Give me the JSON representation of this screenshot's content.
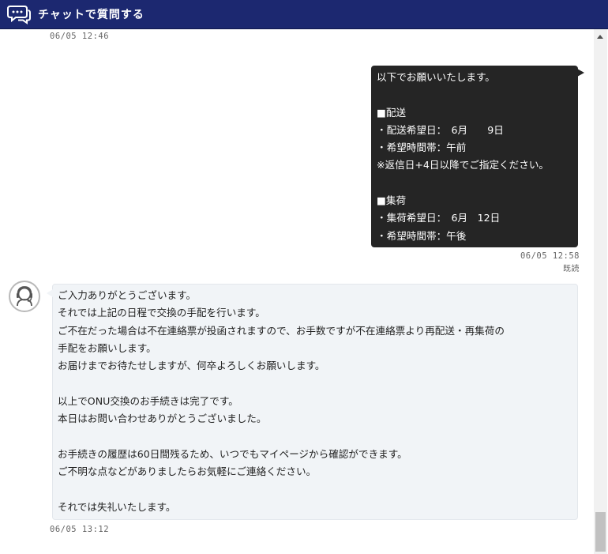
{
  "header": {
    "title": "チャットで質問する"
  },
  "messages": {
    "timestamp_top": "06/05 12:46",
    "user_message": {
      "lines": [
        "以下でお願いいたします。",
        "",
        "■配送",
        "・配送希望日：　6月　　9日",
        "・希望時間帯：午前",
        "※返信日+4日以降でご指定ください。",
        "",
        "■集荷",
        "・集荷希望日：　6月　12日",
        "・希望時間帯：午後"
      ],
      "timestamp": "06/05 12:58",
      "read_status": "既読"
    },
    "operator_message": {
      "lines": [
        "ご入力ありがとうございます。",
        "それでは上記の日程で交換の手配を行います。",
        "ご不在だった場合は不在連絡票が投函されますので、お手数ですが不在連絡票より再配送・再集荷の",
        "手配をお願いします。",
        "お届けまでお待たせしますが、何卒よろしくお願いします。",
        "",
        "以上でONU交換のお手続きは完了です。",
        "本日はお問い合わせありがとうございました。",
        "",
        "お手続きの履歴は60日間残るため、いつでもマイページから確認ができます。",
        "ご不明な点などがありましたらお気軽にご連絡ください。",
        "",
        "それでは失礼いたします。"
      ],
      "timestamp": "06/05 13:12"
    }
  },
  "icons": {
    "header": "chat-bubbles-icon",
    "operator": "operator-headset-icon"
  },
  "colors": {
    "header_bg": "#1c2870",
    "user_bubble_bg": "#252525",
    "operator_bubble_bg": "#f1f4f7"
  }
}
